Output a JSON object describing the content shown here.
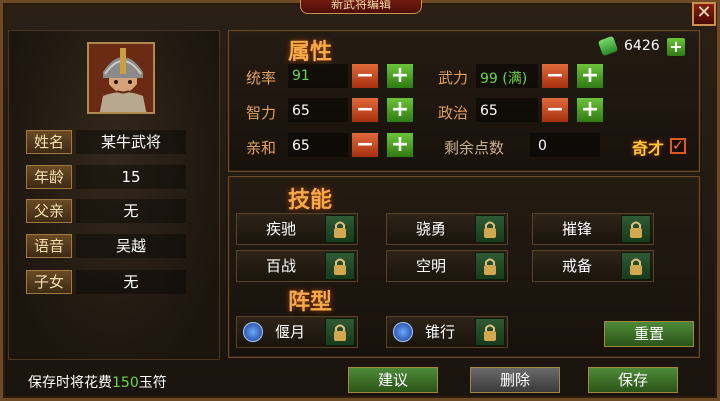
{
  "window": {
    "title": "新武将编辑",
    "close_glyph": "✕"
  },
  "general": {
    "rows": [
      {
        "label": "姓名",
        "value": "某牛武将"
      },
      {
        "label": "年龄",
        "value": "15"
      },
      {
        "label": "父亲",
        "value": "无"
      },
      {
        "label": "语音",
        "value": "吴越"
      },
      {
        "label": "子女",
        "value": "无"
      }
    ]
  },
  "currency": {
    "amount": "6426",
    "icon": "jade-icon"
  },
  "attributes": {
    "title": "属性",
    "stats": [
      {
        "label": "统率",
        "value": "91"
      },
      {
        "label": "武力",
        "value": "99 (满)"
      },
      {
        "label": "智力",
        "value": "65"
      },
      {
        "label": "政治",
        "value": "65"
      },
      {
        "label": "亲和",
        "value": "65"
      }
    ],
    "remaining_label": "剩余点数",
    "remaining_value": "0",
    "genius_label": "奇才",
    "genius_checked": true
  },
  "skills": {
    "title": "技能",
    "items": [
      "疾驰",
      "骁勇",
      "摧锋",
      "百战",
      "空明",
      "戒备"
    ]
  },
  "formation": {
    "title": "阵型",
    "items": [
      "偃月",
      "锥行"
    ],
    "reset_label": "重置"
  },
  "footer": {
    "cost_prefix": "保存时将花费",
    "cost_amount": "150",
    "cost_suffix": "玉符",
    "suggest_label": "建议",
    "delete_label": "删除",
    "save_label": "保存"
  },
  "colors": {
    "accent": "#f5a94a",
    "green_value": "#6cd44a",
    "frame": "#6b4a25"
  }
}
